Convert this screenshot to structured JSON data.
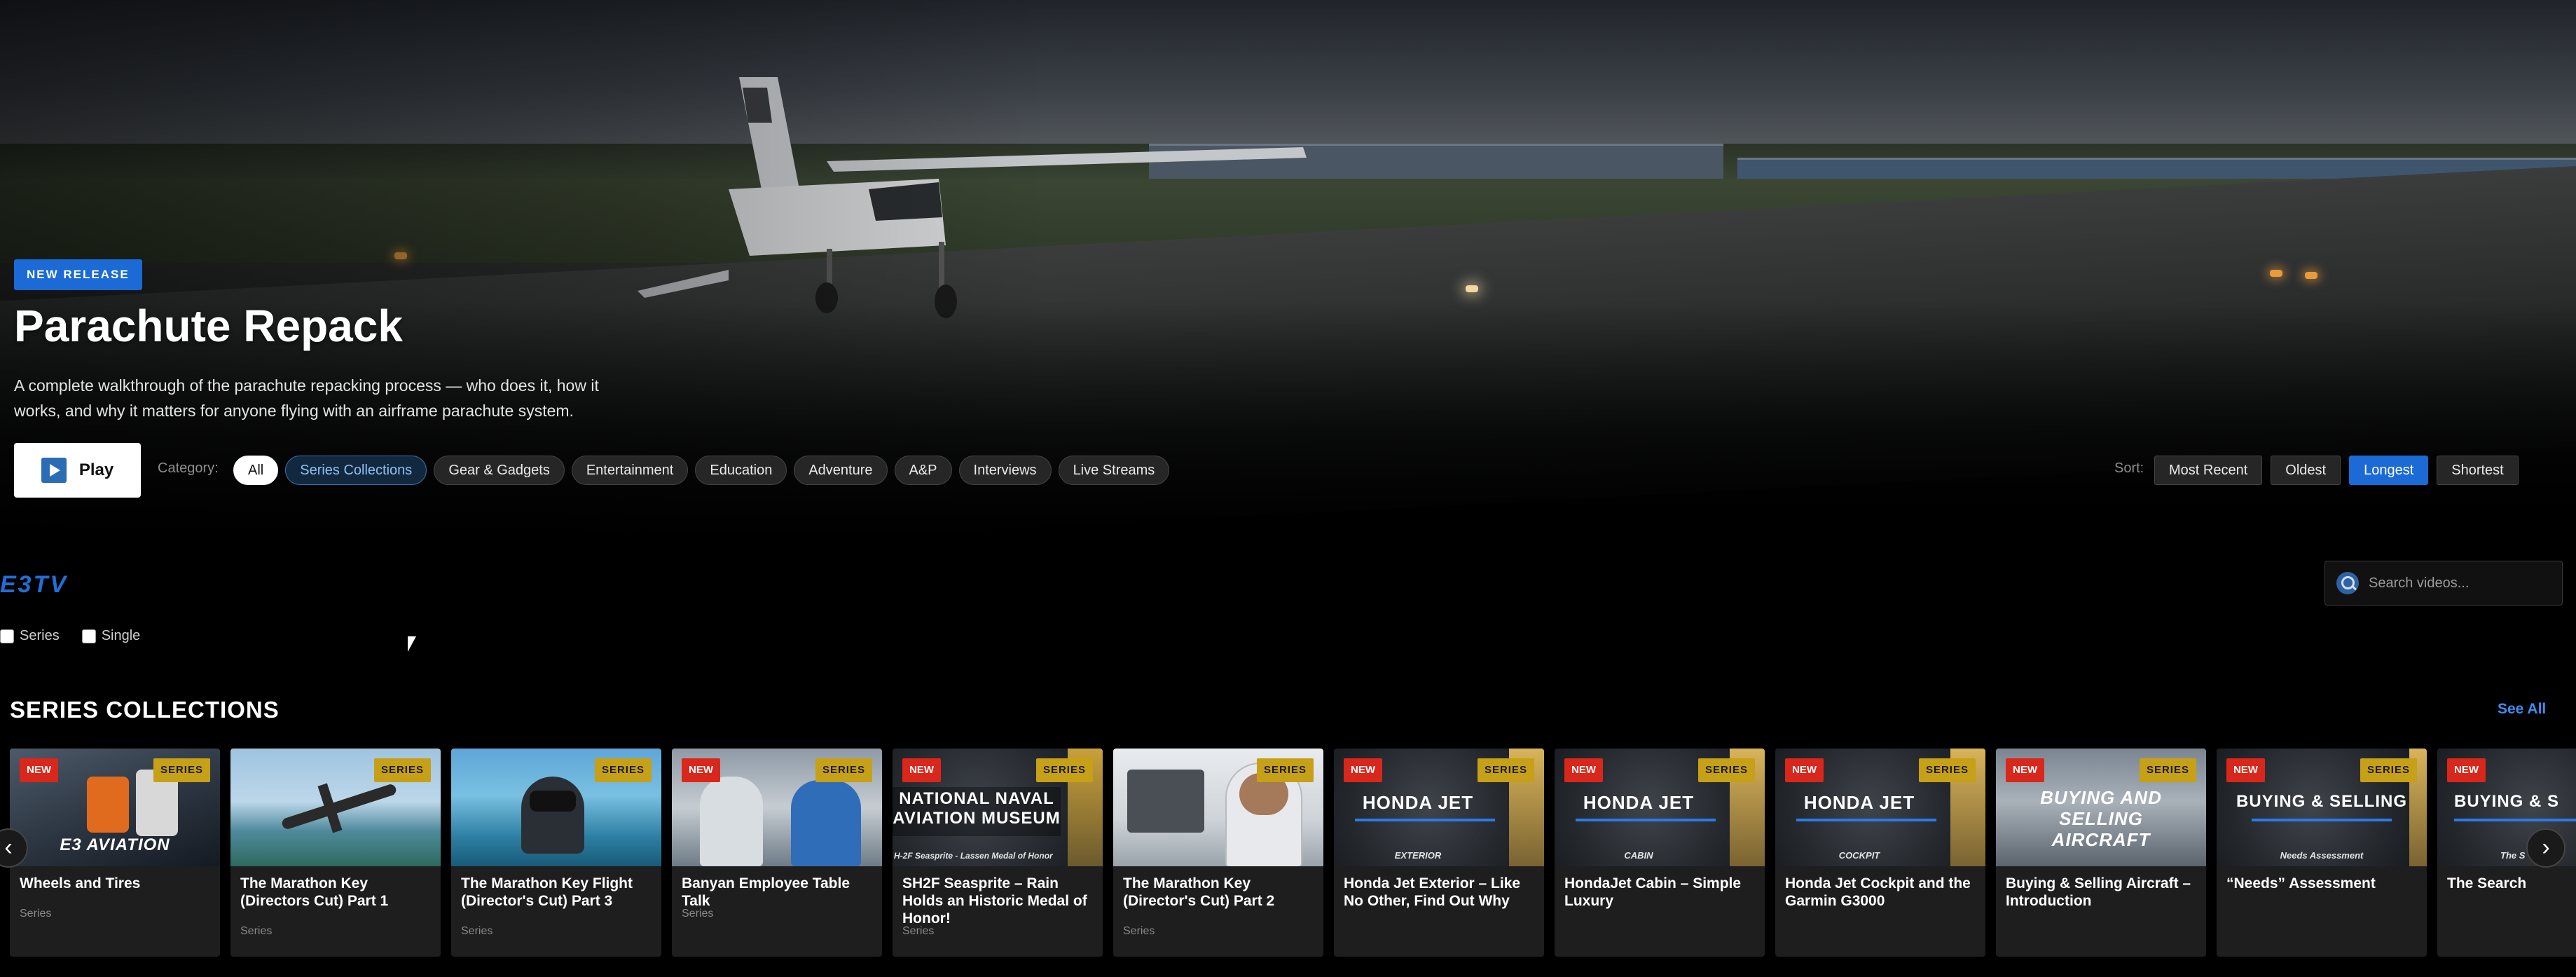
{
  "hero": {
    "badge": "NEW RELEASE",
    "title": "Parachute Repack",
    "description": "A complete walkthrough of the parachute repacking process — who does it, how it works, and why it matters for anyone flying with an airframe parachute system.",
    "play_label": "Play"
  },
  "filters": {
    "category_label": "Category:",
    "categories": [
      "All",
      "Series Collections",
      "Gear & Gadgets",
      "Entertainment",
      "Education",
      "Adventure",
      "A&P",
      "Interviews",
      "Live Streams"
    ],
    "active_category": "All",
    "sort_label": "Sort:",
    "sorts": [
      "Most Recent",
      "Oldest",
      "Longest",
      "Shortest"
    ],
    "active_sort": "Longest"
  },
  "toolbar": {
    "logo": "E3TV",
    "search_placeholder": "Search videos...",
    "type_filters": [
      "Series",
      "Single"
    ]
  },
  "section": {
    "title": "SERIES COLLECTIONS",
    "see_all": "See All",
    "prev_arrow": "‹",
    "next_arrow": "›",
    "cards": [
      {
        "title": "Wheels and Tires",
        "meta": "Series",
        "new": "NEW",
        "series": "SERIES",
        "thumb_text": "E3 AVIATION",
        "thumb_sub": ""
      },
      {
        "title": "The Marathon Key (Directors Cut) Part 1",
        "meta": "Series",
        "new": "",
        "series": "SERIES",
        "thumb_text": "",
        "thumb_sub": ""
      },
      {
        "title": "The Marathon Key Flight (Director's Cut) Part 3",
        "meta": "Series",
        "new": "",
        "series": "SERIES",
        "thumb_text": "",
        "thumb_sub": ""
      },
      {
        "title": "Banyan Employee Table Talk",
        "meta": "Series",
        "new": "NEW",
        "series": "SERIES",
        "thumb_text": "",
        "thumb_sub": ""
      },
      {
        "title": "SH2F Seasprite – Rain Holds an Historic Medal of Honor!",
        "meta": "Series",
        "new": "NEW",
        "series": "SERIES",
        "thumb_text": "NATIONAL NAVAL AVIATION MUSEUM",
        "thumb_sub": "H-2F Seasprite - Lassen Medal of Honor"
      },
      {
        "title": "The Marathon Key (Director's Cut) Part 2",
        "meta": "Series",
        "new": "",
        "series": "SERIES",
        "thumb_text": "",
        "thumb_sub": ""
      },
      {
        "title": "Honda Jet Exterior – Like No Other, Find Out Why",
        "meta": "",
        "new": "NEW",
        "series": "SERIES",
        "thumb_text": "HONDA JET",
        "thumb_sub": "EXTERIOR"
      },
      {
        "title": "HondaJet Cabin – Simple Luxury",
        "meta": "",
        "new": "NEW",
        "series": "SERIES",
        "thumb_text": "HONDA JET",
        "thumb_sub": "CABIN"
      },
      {
        "title": "Honda Jet Cockpit and the Garmin G3000",
        "meta": "",
        "new": "NEW",
        "series": "SERIES",
        "thumb_text": "HONDA JET",
        "thumb_sub": "COCKPIT"
      },
      {
        "title": "Buying & Selling Aircraft – Introduction",
        "meta": "",
        "new": "NEW",
        "series": "SERIES",
        "thumb_text": "BUYING AND SELLING AIRCRAFT",
        "thumb_sub": ""
      },
      {
        "title": "“Needs” Assessment",
        "meta": "",
        "new": "NEW",
        "series": "SERIES",
        "thumb_text": "BUYING & SELLING",
        "thumb_sub": "Needs Assessment"
      },
      {
        "title": "The Search",
        "meta": "",
        "new": "NEW",
        "series": "",
        "thumb_text": "BUYING & S",
        "thumb_sub": "The S"
      }
    ]
  },
  "colors": {
    "accent": "#1c6ad6",
    "new_badge": "#d9271c",
    "series_badge": "#c6a016",
    "link": "#3b8ef0"
  }
}
